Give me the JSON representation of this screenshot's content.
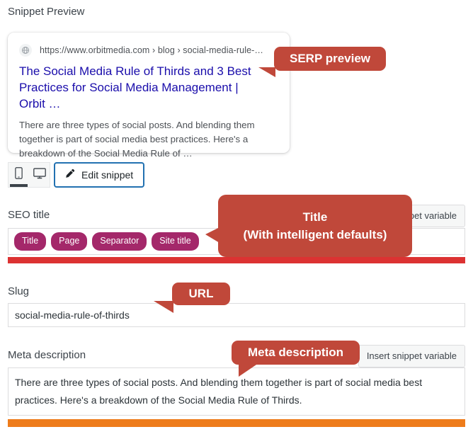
{
  "preview": {
    "heading": "Snippet Preview",
    "favicon_icon": "globe-icon",
    "url": "https://www.orbitmedia.com › blog › social-media-rule-…",
    "title": "The Social Media Rule of Thirds and 3 Best Practices for Social Media Management | Orbit …",
    "description": "There are three types of social posts. And blending them together is part of social media best practices. Here's a breakdown of the Social Media Rule of …"
  },
  "toolbar": {
    "mobile_icon": "mobile-phone-icon",
    "desktop_icon": "desktop-monitor-icon",
    "active_device": "mobile",
    "edit_snippet_label": "Edit snippet",
    "edit_snippet_icon": "pencil-icon"
  },
  "seo_title": {
    "label": "SEO title",
    "insert_variable_label": "Insert snippet variable",
    "tokens": [
      "Title",
      "Page",
      "Separator",
      "Site title"
    ],
    "progress_percent": 100,
    "progress_color": "#dc3232"
  },
  "slug": {
    "label": "Slug",
    "value": "social-media-rule-of-thirds"
  },
  "meta_description": {
    "label": "Meta description",
    "insert_variable_label": "Insert snippet variable",
    "value": "There are three types of social posts. And blending them together is part of social media best practices. Here's a breakdown of the Social Media Rule of Thirds.",
    "progress_percent": 100,
    "progress_color": "#ee7c1b"
  },
  "annotations": {
    "serp_preview": "SERP preview",
    "title_line1": "Title",
    "title_line2": "(With intelligent defaults)",
    "url": "URL",
    "meta_description": "Meta description",
    "color": "#c0483a"
  },
  "colors": {
    "token_pill": "#a4286a",
    "link": "#1a0dab",
    "primary_button_border": "#2271b1"
  }
}
